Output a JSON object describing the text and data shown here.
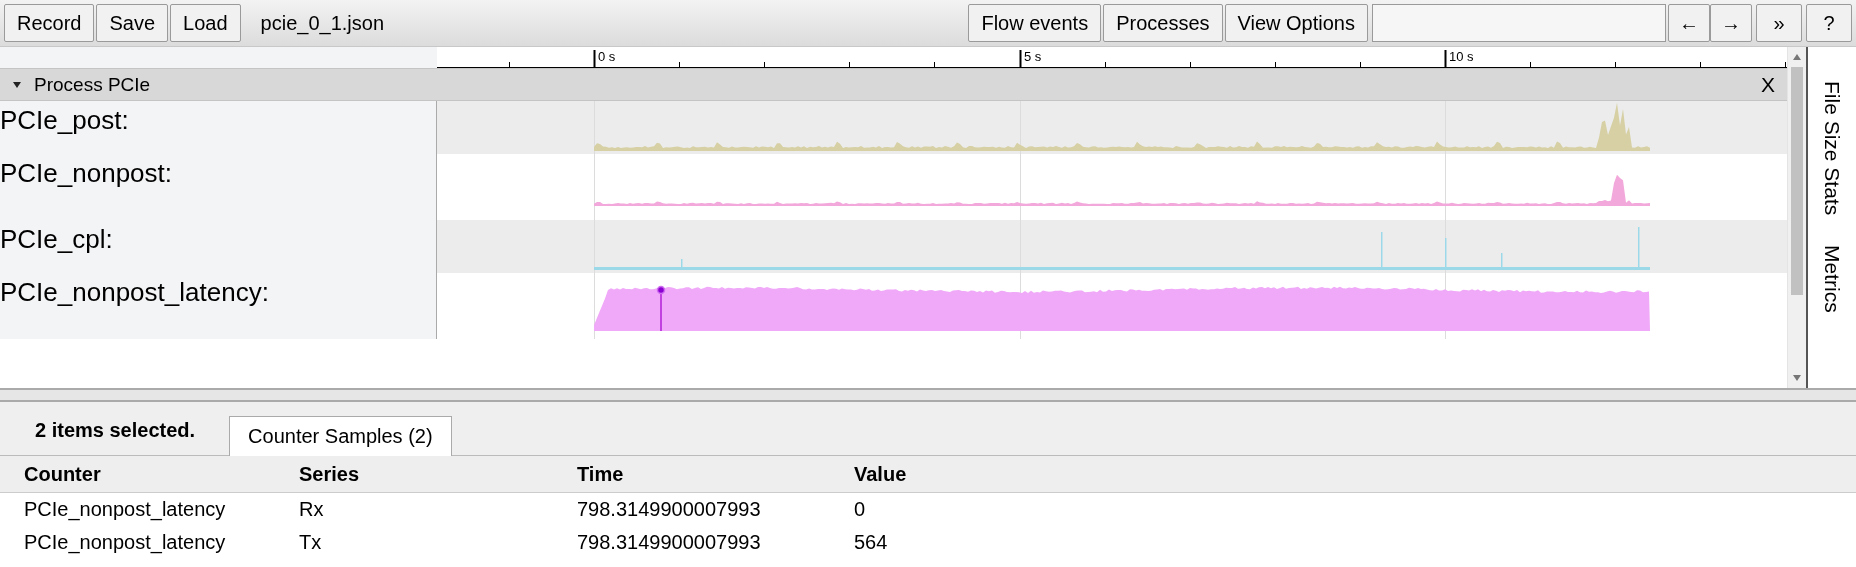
{
  "toolbar": {
    "buttons": [
      "Record",
      "Save",
      "Load"
    ],
    "filename": "pcie_0_1.json",
    "right_buttons": [
      "Flow events",
      "Processes",
      "View Options"
    ],
    "nav_buttons": [
      "←",
      "→"
    ],
    "more_button": "»",
    "help_button": "?"
  },
  "ruler": {
    "ticks": [
      "0 s",
      "5 s",
      "10 s"
    ]
  },
  "process": {
    "title": "Process PCIe",
    "expanded": true,
    "close": "X"
  },
  "tracks": [
    {
      "label": "PCIe_post:",
      "kind": "bursty",
      "color": "#d6d0a4"
    },
    {
      "label": "PCIe_nonpost:",
      "kind": "low",
      "color": "#f2a8da"
    },
    {
      "label": "PCIe_cpl:",
      "kind": "spikes",
      "color": "#9bd9e8"
    },
    {
      "label": "PCIe_nonpost_latency:",
      "kind": "filled",
      "color": "#f0a8f8",
      "selected_sample": true
    }
  ],
  "side_panel": {
    "tabs": [
      "File Size Stats",
      "Metrics"
    ]
  },
  "analysis": {
    "summary": "2 items selected.",
    "tabs": [
      {
        "label": "Counter Samples (2)",
        "selected": true
      }
    ],
    "table": {
      "columns": [
        "Counter",
        "Series",
        "Time",
        "Value"
      ],
      "rows": [
        [
          "PCIe_nonpost_latency",
          "Rx",
          "798.3149900007993",
          "0"
        ],
        [
          "PCIe_nonpost_latency",
          "Tx",
          "798.3149900007993",
          "564"
        ]
      ]
    }
  }
}
